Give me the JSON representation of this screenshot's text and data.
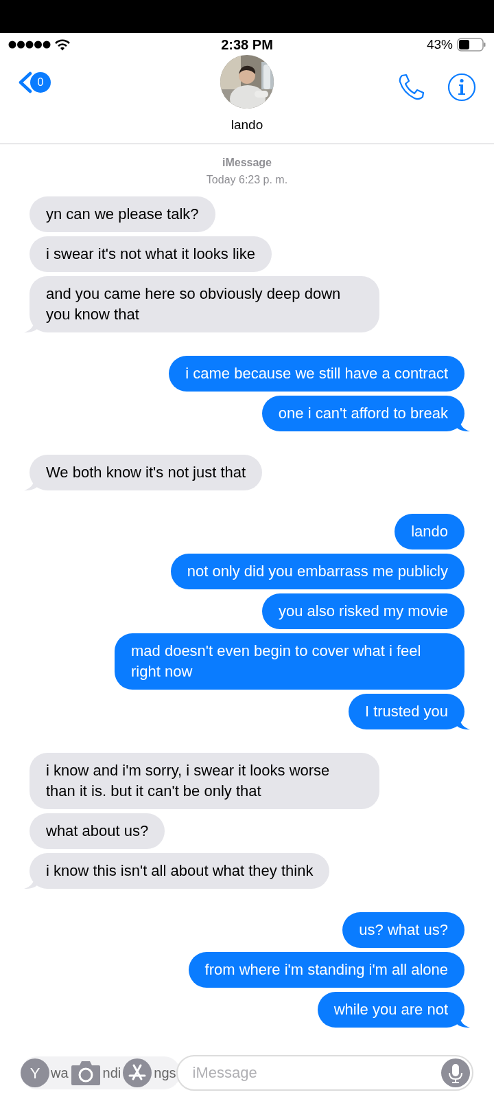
{
  "status_bar": {
    "time": "2:38 PM",
    "battery": "43%"
  },
  "nav": {
    "unread_count": "0",
    "contact_name": "lando"
  },
  "header": {
    "service": "iMessage",
    "timestamp": "Today 6:23 p. m."
  },
  "messages": [
    {
      "kind": "received",
      "text": "yn can we please talk?",
      "tail": false
    },
    {
      "kind": "received",
      "text": "i swear it's not what it looks like",
      "tail": false
    },
    {
      "kind": "received",
      "text": "and you came here so obviously deep down you know that",
      "tail": true
    },
    {
      "kind": "sent",
      "text": "i came because we still have a contract",
      "tail": false
    },
    {
      "kind": "sent",
      "text": "one i can't afford to break",
      "tail": true
    },
    {
      "kind": "received",
      "text": "We both know it's not just that",
      "tail": true
    },
    {
      "kind": "sent",
      "text": "lando",
      "tail": false
    },
    {
      "kind": "sent",
      "text": "not only did you embarrass me publicly",
      "tail": false
    },
    {
      "kind": "sent",
      "text": "you also risked my movie",
      "tail": false
    },
    {
      "kind": "sent",
      "text": "mad doesn't even begin to cover what i feel right now",
      "tail": false
    },
    {
      "kind": "sent",
      "text": "I trusted you",
      "tail": true
    },
    {
      "kind": "received",
      "text": "i know and i'm sorry, i swear it looks worse than it is. but it can't be only that",
      "tail": false
    },
    {
      "kind": "received",
      "text": "what about us?",
      "tail": false
    },
    {
      "kind": "received",
      "text": "i know this isn't all about what they think",
      "tail": true
    },
    {
      "kind": "sent",
      "text": "us? what us?",
      "tail": false
    },
    {
      "kind": "sent",
      "text": "from where i'm standing i'm all alone",
      "tail": false
    },
    {
      "kind": "sent",
      "text": "while you are not",
      "tail": true
    }
  ],
  "compose": {
    "initial": "Y",
    "hidden_fragments": [
      "wa",
      "ndi",
      "ngs"
    ],
    "placeholder": "iMessage"
  }
}
